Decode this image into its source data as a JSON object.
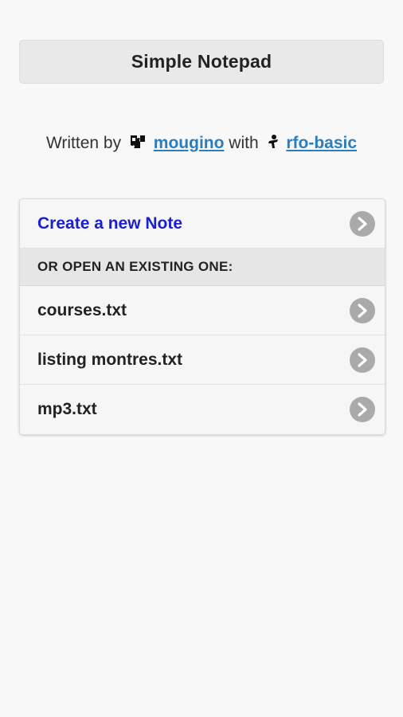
{
  "header": {
    "title": "Simple Notepad"
  },
  "credits": {
    "prefix": "Written by",
    "author": "mougino",
    "middle": "with",
    "tool": "rfo-basic",
    "author_icon": "puzzle-icon",
    "tool_icon": "figure-icon"
  },
  "list": {
    "create_label": "Create a new Note",
    "section_label": "OR OPEN AN EXISTING ONE:",
    "files": [
      {
        "name": "courses.txt"
      },
      {
        "name": "listing montres.txt"
      },
      {
        "name": "mp3.txt"
      }
    ],
    "chevron_icon": "chevron-right-icon"
  },
  "colors": {
    "background": "#f8f8f8",
    "accent": "#1a1fd0",
    "link": "#2a7dbf",
    "chevron": "#aaaaaa"
  }
}
